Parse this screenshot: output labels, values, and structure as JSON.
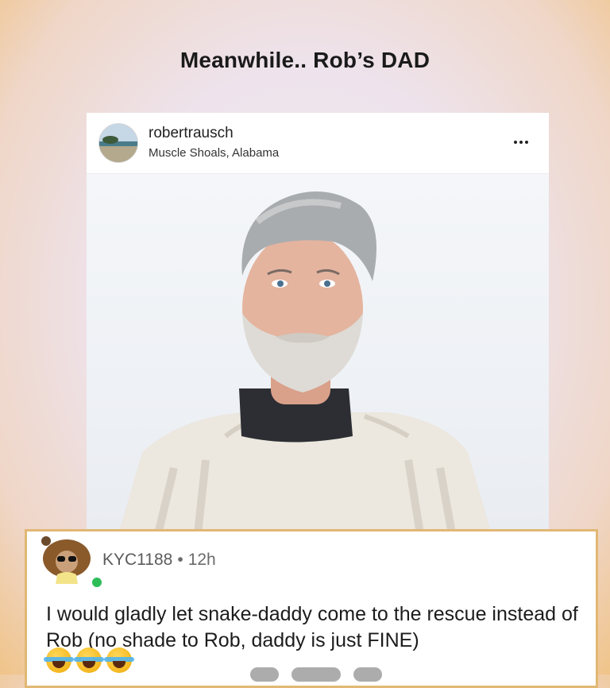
{
  "page": {
    "title": "Meanwhile.. Rob’s DAD"
  },
  "post": {
    "username": "robertrausch",
    "location": "Muscle Shoals, Alabama",
    "more_icon": "more-horizontal-icon"
  },
  "comment": {
    "author": "KYC1188",
    "separator": "•",
    "time": "12h",
    "text": "I would gladly let snake-daddy come to the rescue instead of Rob (no shade to Rob, daddy is just FINE)",
    "emojis": [
      "😂",
      "😂",
      "😂"
    ],
    "online_color": "#2ebd59"
  },
  "colors": {
    "card_border": "#e1b874",
    "accent_background": "#f0c489"
  }
}
